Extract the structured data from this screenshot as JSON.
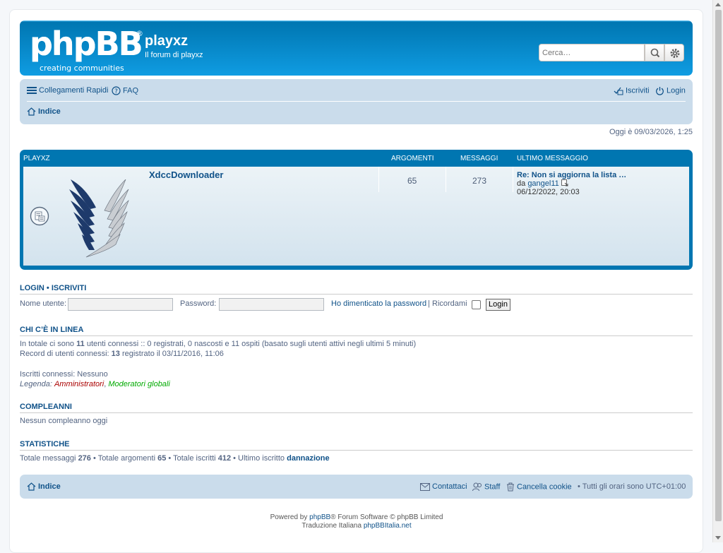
{
  "header": {
    "logo_text": "phpBB",
    "logo_sub": "creating communities",
    "site_title": "playxz",
    "site_desc": "Il forum di playxz",
    "search_placeholder": "Cerca…"
  },
  "navbar": {
    "quick_links": "Collegamenti Rapidi",
    "faq": "FAQ",
    "register": "Iscriviti",
    "login": "Login",
    "breadcrumb": "Indice"
  },
  "time_text": "Oggi è 09/03/2026, 1:25",
  "forum_table": {
    "headers": {
      "forum": "PLAYXZ",
      "topics": "ARGOMENTI",
      "posts": "MESSAGGI",
      "last_post": "ULTIMO MESSAGGIO"
    },
    "rows": [
      {
        "name": "XdccDownloader",
        "topics": "65",
        "posts": "273",
        "last_title": "Re: Non si aggiorna la lista …",
        "last_by_prefix": "da",
        "last_by": "gangel11",
        "last_date": "06/12/2022, 20:03"
      }
    ]
  },
  "login_box": {
    "title_login": "LOGIN",
    "title_sep": "•",
    "title_register": "ISCRIVITI",
    "username_label": "Nome utente:",
    "password_label": "Password:",
    "forgot": "Ho dimenticato la password",
    "pipe": "|",
    "remember": "Ricordami",
    "button": "Login"
  },
  "online": {
    "title": "CHI C’È IN LINEA",
    "line1_a": "In totale ci sono",
    "line1_num": "11",
    "line1_b": "utenti connessi :: 0 registrati, 0 nascosti e 11 ospiti (basato sugli utenti attivi negli ultimi 5 minuti)",
    "line2_a": "Record di utenti connessi:",
    "line2_num": "13",
    "line2_b": "registrato il 03/11/2016, 11:06",
    "line3": "Iscritti connessi: Nessuno",
    "legend_label": "Legenda:",
    "legend_admin": "Amministratori",
    "legend_comma": ",",
    "legend_mods": "Moderatori globali",
    "admin_color": "#AA0000",
    "mods_color": "#00AA00"
  },
  "birthdays": {
    "title": "COMPLEANNI",
    "text": "Nessun compleanno oggi"
  },
  "stats": {
    "title": "STATISTICHE",
    "t1": "Totale messaggi",
    "v1": "276",
    "t2": "• Totale argomenti",
    "v2": "65",
    "t3": "• Totale iscritti",
    "v3": "412",
    "t4": "• Ultimo iscritto",
    "v4": "dannazione"
  },
  "footer": {
    "breadcrumb": "Indice",
    "contact": "Contattaci",
    "staff": "Staff",
    "cookies": "Cancella cookie",
    "timezone": "• Tutti gli orari sono UTC+01:00",
    "powered_a": "Powered by",
    "powered_link": "phpBB",
    "powered_b": "® Forum Software © phpBB Limited",
    "translation_a": "Traduzione Italiana",
    "translation_link": "phpBBItalia.net"
  },
  "colors": {
    "header_blue": "#12A3EB",
    "nav_bg": "#CADCEB",
    "link": "#105289"
  }
}
